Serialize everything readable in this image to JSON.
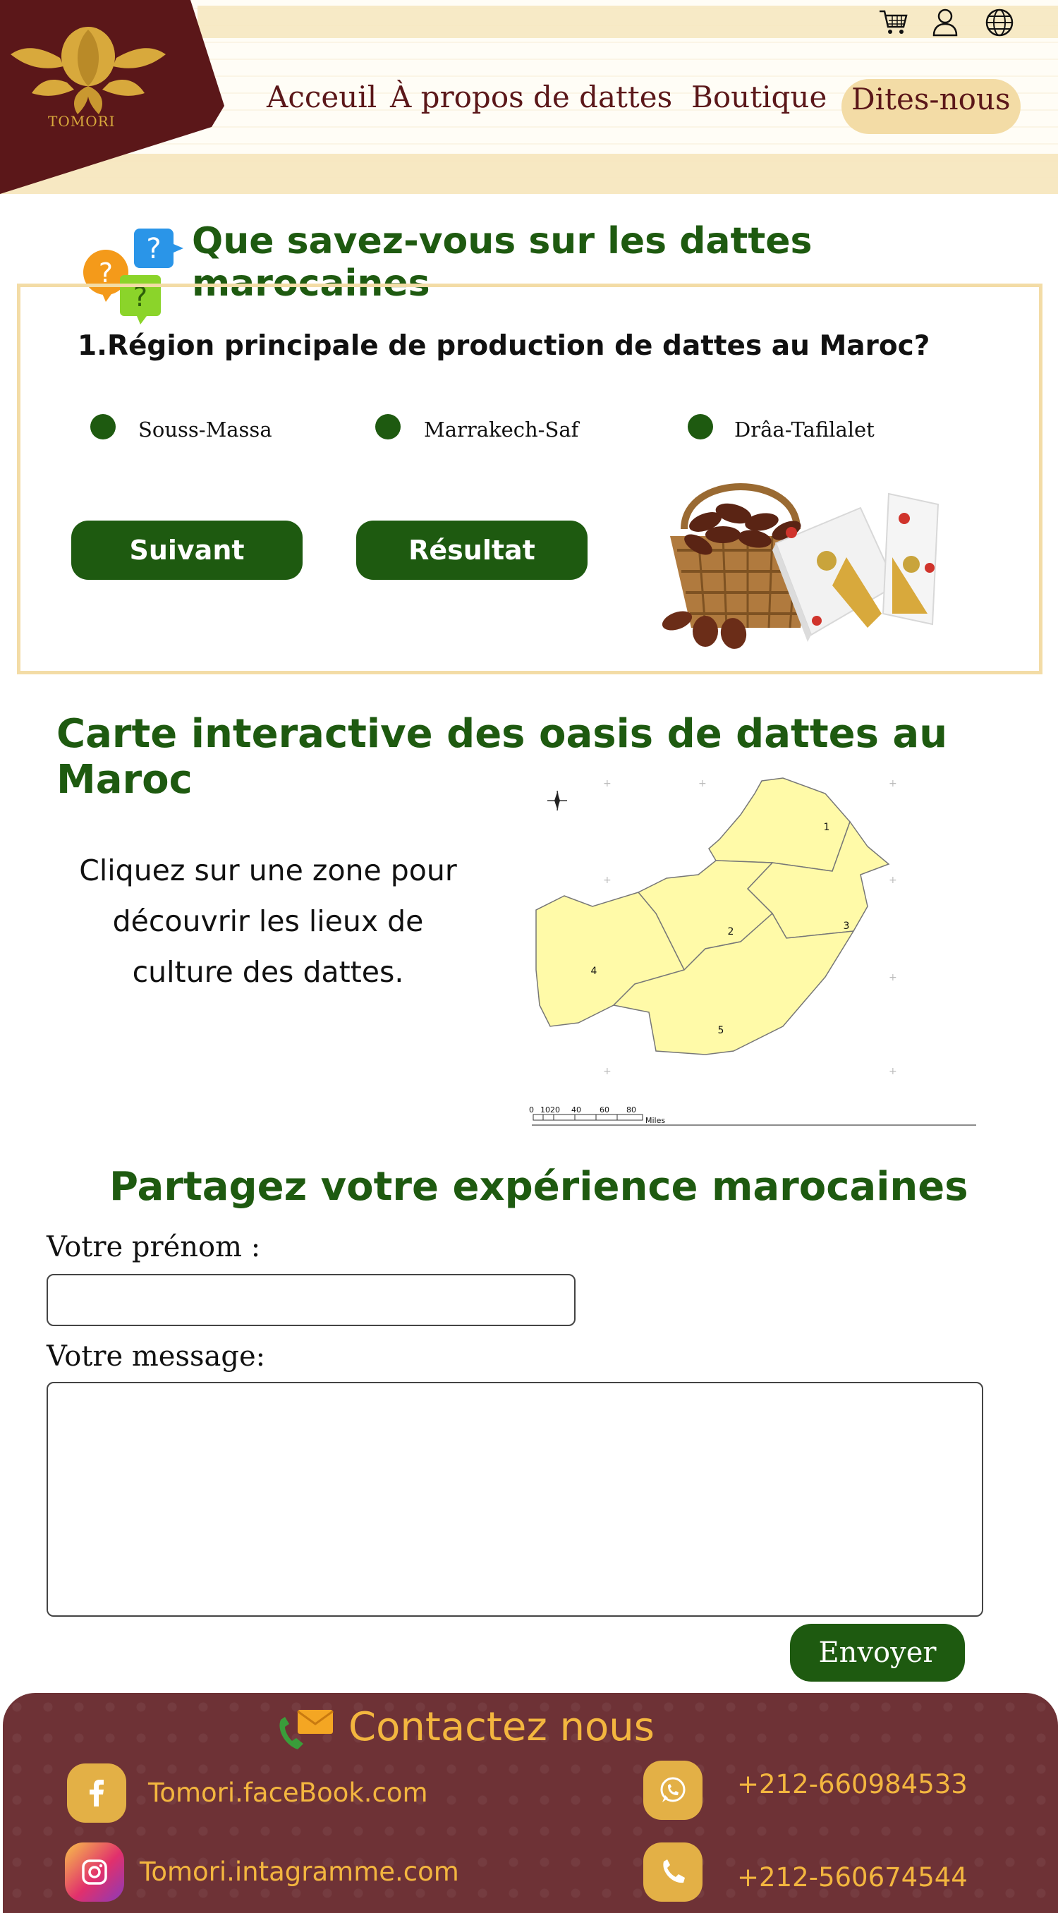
{
  "header": {
    "logo_text": "TOMORI",
    "nav": [
      {
        "label": "Acceuil"
      },
      {
        "label": "À propos de dattes"
      },
      {
        "label": "Boutique"
      },
      {
        "label": "Dites-nous"
      }
    ],
    "icons": [
      "cart-icon",
      "user-icon",
      "globe-icon"
    ]
  },
  "quiz": {
    "title": "Que savez-vous sur les dattes marocaines",
    "question": "1.Région principale de production de dattes au Maroc?",
    "options": [
      "Souss-Massa",
      "Marrakech-Saf",
      "Drâa-Tafilalet"
    ],
    "next_label": "Suivant",
    "result_label": "Résultat"
  },
  "map": {
    "title": "Carte interactive des oasis de dattes au Maroc",
    "instruction": "Cliquez sur une zone pour découvrir les lieux de culture des dattes.",
    "zones": [
      "1",
      "2",
      "3",
      "4",
      "5"
    ],
    "scale_ticks": [
      "0",
      "10",
      "20",
      "40",
      "60",
      "80"
    ],
    "scale_unit": "Miles"
  },
  "share": {
    "title": "Partagez votre expérience marocaines",
    "first_name_label": "Votre prénom :",
    "message_label": "Votre message:",
    "send_label": "Envoyer"
  },
  "contact": {
    "title": "Contactez nous",
    "facebook": "Tomori.faceBook.com",
    "instagram": "Tomori.intagramme.com",
    "whatsapp": "+212-660984533",
    "phone": "+212-560674544"
  },
  "colors": {
    "brand_maroon": "#5b1719",
    "accent_gold": "#f3dca6",
    "title_green": "#1e5a10",
    "footer_bg": "#6e3236",
    "footer_text": "#f3b63f"
  }
}
